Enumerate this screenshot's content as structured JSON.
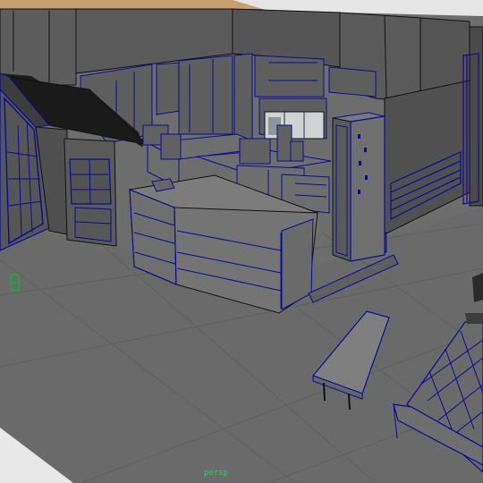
{
  "viewport": {
    "camera_label": "persp",
    "colors": {
      "background": "#6d6d6d",
      "floor": "#6b6b6b",
      "floor_far": "#717171",
      "wall": "#5b5b5b",
      "wall_dark": "#4e4e4e",
      "surface_light": "#7a7a7a",
      "wire": "#0a0a9a",
      "wire_black": "#111111",
      "roof": "#1c1c1c",
      "camera_text": "#2ad15a",
      "floor_object": "#22a33a"
    }
  }
}
